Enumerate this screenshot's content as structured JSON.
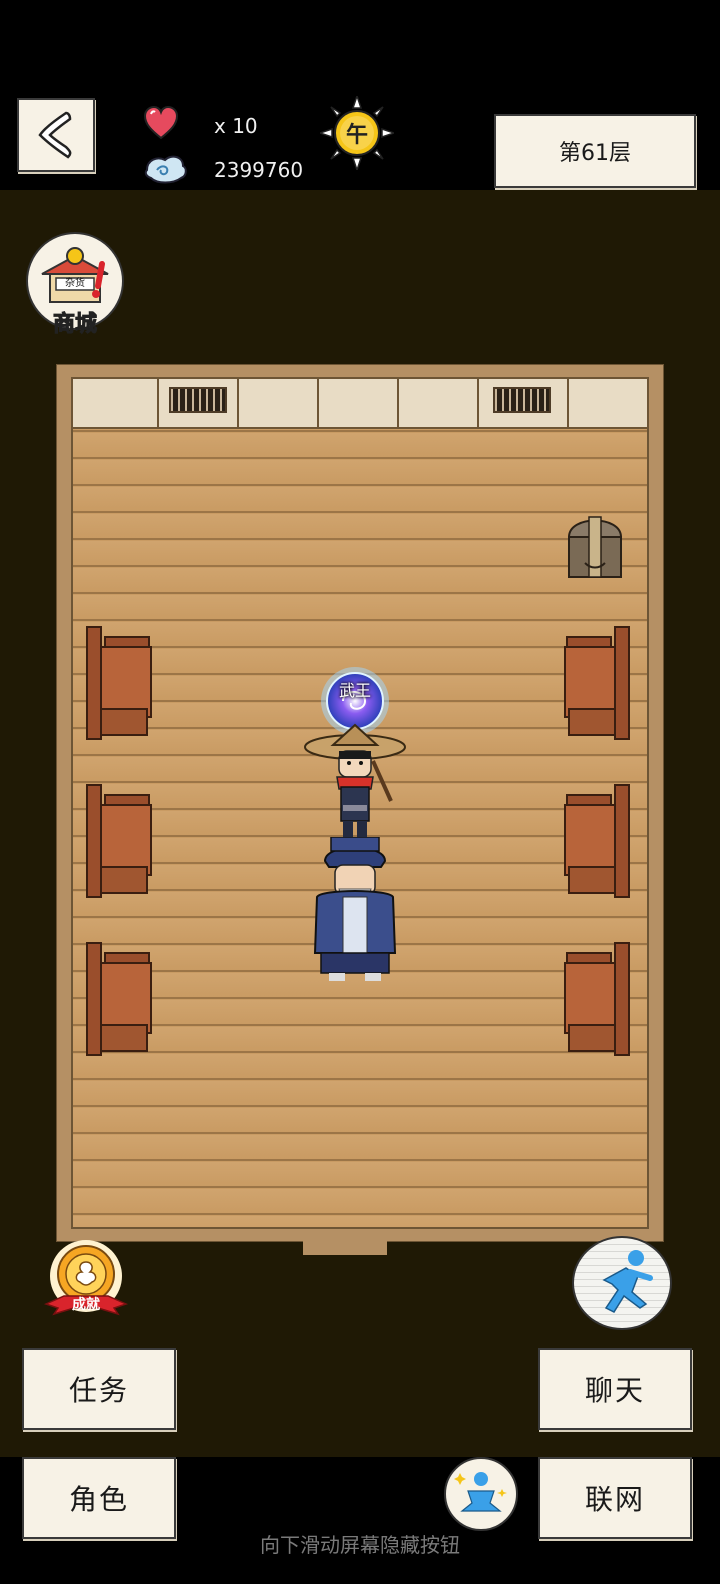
{
  "hud": {
    "lives_label": "x 10",
    "currency_value": "2399760",
    "time_glyph": "午",
    "floor_label": "第61层"
  },
  "shop": {
    "label": "商城",
    "sign_text": "杂货"
  },
  "scene": {
    "npc_title": "武王"
  },
  "buttons": {
    "achievements_label": "成就",
    "quest_label": "任务",
    "chat_label": "聊天",
    "character_label": "角色",
    "online_label": "联网"
  },
  "hint_text": "向下滑动屏幕隐藏按钮",
  "colors": {
    "background": "#1f1905",
    "paper": "#f7f2e6",
    "heart": "#e64a5e",
    "sun": "#f5c518"
  },
  "icons": [
    "back-chevron-icon",
    "heart-icon",
    "spirit-cloud-icon",
    "sun-time-icon",
    "shop-icon",
    "achievement-medal-icon",
    "run-icon",
    "meditate-icon",
    "treasure-chest-icon",
    "chair-icon"
  ]
}
